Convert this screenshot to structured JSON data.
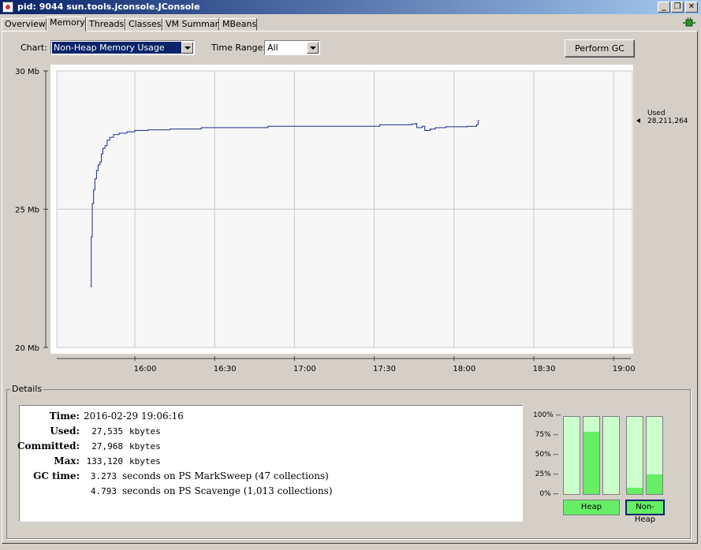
{
  "window": {
    "title": "pid: 9044 sun.tools.jconsole.JConsole",
    "controls": [
      "_",
      "❐",
      "✕"
    ]
  },
  "tabs": [
    {
      "label": "Overview"
    },
    {
      "label": "Memory"
    },
    {
      "label": "Threads"
    },
    {
      "label": "Classes"
    },
    {
      "label": "VM Summary"
    },
    {
      "label": "MBeans"
    }
  ],
  "active_tab": "Memory",
  "toolbar": {
    "chart_label": "Chart:",
    "chart_value": "Non-Heap Memory Usage",
    "time_range_label": "Time Range:",
    "time_range_value": "All",
    "gc_button": "Perform GC"
  },
  "chart_data": {
    "type": "line",
    "title": "",
    "xlabel": "",
    "ylabel": "",
    "y_ticks": [
      "30 Mb",
      "25 Mb",
      "20 Mb"
    ],
    "x_ticks": [
      "16:00",
      "16:30",
      "17:00",
      "17:30",
      "18:00",
      "18:30",
      "19:00"
    ],
    "ylim_mb": [
      20,
      30
    ],
    "x_range_minutes_from_1600": [
      -17,
      36
    ],
    "grid": true,
    "series": [
      {
        "name": "Used",
        "color": "#1c2a8c",
        "points": [
          [
            -16.7,
            22.2
          ],
          [
            -16.4,
            24.0
          ],
          [
            -16.0,
            25.2
          ],
          [
            -15.5,
            25.7
          ],
          [
            -15.0,
            26.1
          ],
          [
            -14.4,
            26.4
          ],
          [
            -13.8,
            26.6
          ],
          [
            -13.1,
            26.7
          ],
          [
            -12.6,
            27.0
          ],
          [
            -12.0,
            27.2
          ],
          [
            -11.2,
            27.3
          ],
          [
            -10.4,
            27.5
          ],
          [
            -9.4,
            27.6
          ],
          [
            -8.0,
            27.7
          ],
          [
            -5.9,
            27.75
          ],
          [
            -3.0,
            27.8
          ],
          [
            0.0,
            27.85
          ],
          [
            5.0,
            27.87
          ],
          [
            13.2,
            27.9
          ],
          [
            25.0,
            27.95
          ],
          [
            50.0,
            28.0
          ],
          [
            92.0,
            28.05
          ],
          [
            104.0,
            28.08
          ],
          [
            105.5,
            28.1
          ],
          [
            106.0,
            27.95
          ],
          [
            108.0,
            28.0
          ],
          [
            109.0,
            27.85
          ],
          [
            111.0,
            27.9
          ],
          [
            113.0,
            27.95
          ],
          [
            117.0,
            27.98
          ],
          [
            125.0,
            28.0
          ],
          [
            127.0,
            28.0
          ],
          [
            128.5,
            28.05
          ],
          [
            129.0,
            28.2
          ],
          [
            129.5,
            28.2
          ]
        ]
      }
    ],
    "annotation": {
      "label": "Used",
      "value": "28,211,264"
    }
  },
  "details": {
    "title": "Details",
    "time_label": "Time:",
    "time_value": "2016-02-29 19:06:16",
    "used_label": "Used:",
    "used_value": "27,535",
    "used_unit": "kbytes",
    "committed_label": "Committed:",
    "committed_value": "27,968",
    "committed_unit": "kbytes",
    "max_label": "Max:",
    "max_value": "133,120",
    "max_unit": "kbytes",
    "gc_label": "GC time:",
    "gc1_value": "3.273",
    "gc1_text": "seconds on PS MarkSweep (47 collections)",
    "gc2_value": "4.793",
    "gc2_text": "seconds on PS Scavenge (1,013 collections)"
  },
  "pools": {
    "scale": [
      "100% --",
      "75% --",
      "50% --",
      "25% --",
      "0% --"
    ],
    "heap_fills": [
      0,
      0.81,
      0
    ],
    "nonheap_fills": [
      0.08,
      0.26
    ],
    "heap_label": "Heap",
    "nonheap_label": "Non-Heap"
  }
}
